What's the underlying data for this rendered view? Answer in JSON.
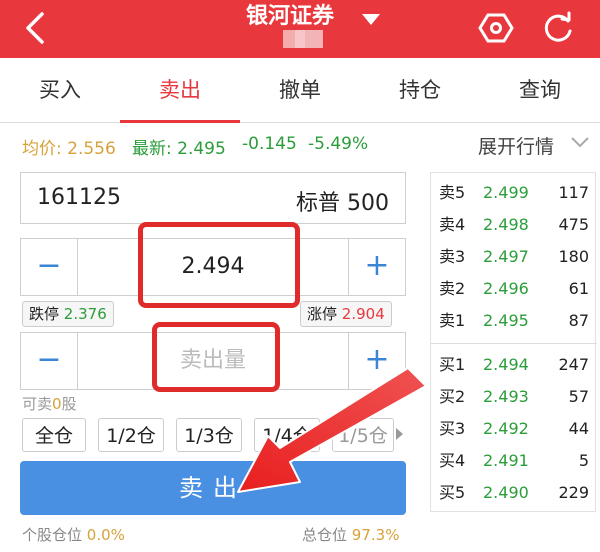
{
  "header": {
    "title": "银河证券",
    "back_icon": "back-arrow-icon",
    "settings_icon": "hexagon-settings-icon",
    "refresh_icon": "refresh-icon",
    "bg_color": "#e8383d"
  },
  "tabs": [
    {
      "label": "买入"
    },
    {
      "label": "卖出"
    },
    {
      "label": "撤单"
    },
    {
      "label": "持仓"
    },
    {
      "label": "查询"
    }
  ],
  "info": {
    "avg_label": "均价:",
    "avg_value": "2.556",
    "latest_label": "最新:",
    "latest_value": "2.495",
    "change": "-0.145",
    "change_pct": "-5.49%",
    "expand_label": "展开行情"
  },
  "stock": {
    "code": "161125",
    "name": "标普 500"
  },
  "price": {
    "value": "2.494",
    "limit_down_label": "跌停",
    "limit_down": "2.376",
    "limit_up_label": "涨停",
    "limit_up": "2.904"
  },
  "quantity": {
    "placeholder": "卖出量",
    "available_label": "可卖",
    "available_value": "0",
    "available_unit": "股"
  },
  "positions": [
    "全仓",
    "1/2仓",
    "1/3仓",
    "1/4仓",
    "1/5仓"
  ],
  "sell_button": "卖出",
  "footer": {
    "stock_pos_label": "个股仓位",
    "stock_pos_value": "0.0%",
    "total_pos_label": "总仓位",
    "total_pos_value": "97.3%"
  },
  "orderbook": {
    "asks": [
      {
        "label": "卖5",
        "price": "2.499",
        "volume": "117"
      },
      {
        "label": "卖4",
        "price": "2.498",
        "volume": "475"
      },
      {
        "label": "卖3",
        "price": "2.497",
        "volume": "180"
      },
      {
        "label": "卖2",
        "price": "2.496",
        "volume": "61"
      },
      {
        "label": "卖1",
        "price": "2.495",
        "volume": "87"
      }
    ],
    "bids": [
      {
        "label": "买1",
        "price": "2.494",
        "volume": "247"
      },
      {
        "label": "买2",
        "price": "2.493",
        "volume": "57"
      },
      {
        "label": "买3",
        "price": "2.492",
        "volume": "44"
      },
      {
        "label": "买4",
        "price": "2.491",
        "volume": "5"
      },
      {
        "label": "买5",
        "price": "2.490",
        "volume": "229"
      }
    ]
  }
}
